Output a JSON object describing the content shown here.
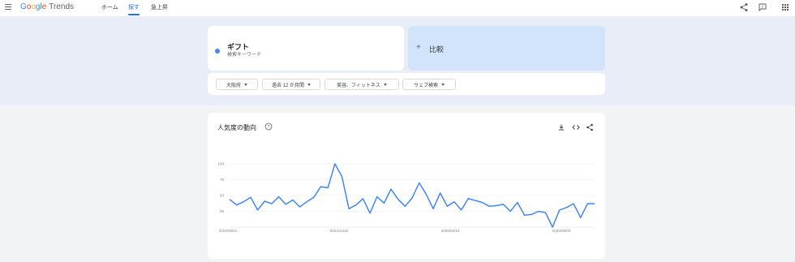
{
  "header": {
    "logo_google": [
      "G",
      "o",
      "o",
      "g",
      "l",
      "e"
    ],
    "logo_trends": "Trends",
    "nav": [
      {
        "label": "ホーム"
      },
      {
        "label": "探す"
      },
      {
        "label": "急上昇"
      }
    ],
    "active_tab": "探す",
    "icons": [
      "menu-icon",
      "share-icon",
      "feedback-icon",
      "apps-grid-icon"
    ]
  },
  "search_term": {
    "title": "ギフト",
    "subtitle": "検索キーワード",
    "color": "#4285f4"
  },
  "compare": {
    "label": "比較",
    "icon": "plus-icon"
  },
  "filters": [
    {
      "label": "大阪府"
    },
    {
      "label": "過去 12 か月間"
    },
    {
      "label": "美容、フィットネス"
    },
    {
      "label": "ウェブ検索"
    }
  ],
  "chart_card": {
    "title": "人気度の動向",
    "icons": [
      "help-icon",
      "download-icon",
      "embed-icon",
      "share-icon"
    ]
  },
  "chart_data": {
    "type": "line",
    "title": "",
    "xlabel": "",
    "ylabel": "",
    "ylim": [
      0,
      100
    ],
    "yticks": [
      25,
      50,
      75,
      100
    ],
    "xtick_labels": [
      "2024/09/01",
      "2024/12/22",
      "2025/04/13",
      "2025/08/03"
    ],
    "grid": true,
    "series": [
      {
        "color": "#4285f4",
        "values": [
          44,
          35,
          40,
          47,
          27,
          41,
          37,
          48,
          36,
          43,
          32,
          40,
          47,
          64,
          62,
          100,
          80,
          29,
          35,
          45,
          22,
          48,
          38,
          60,
          44,
          33,
          46,
          70,
          52,
          29,
          54,
          33,
          40,
          27,
          45,
          42,
          39,
          33,
          34,
          36,
          25,
          39,
          19,
          20,
          25,
          23,
          0,
          27,
          31,
          37,
          15,
          37,
          37
        ]
      }
    ]
  }
}
